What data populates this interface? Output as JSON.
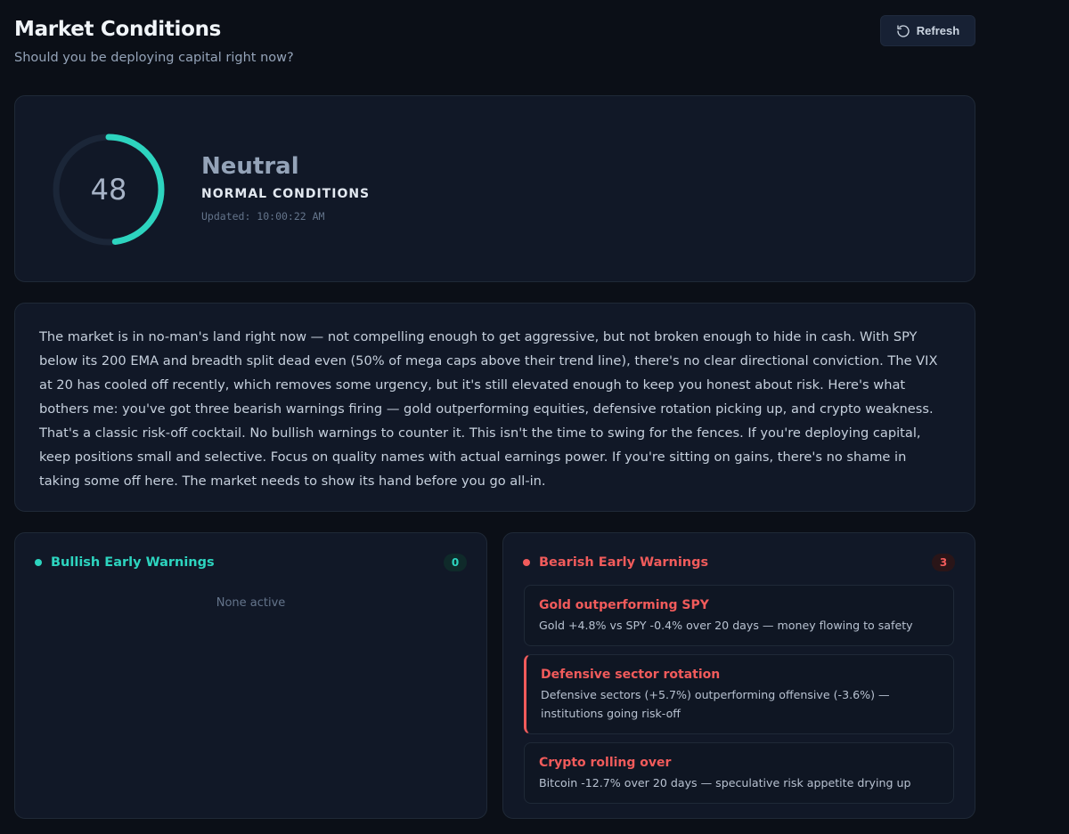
{
  "header": {
    "title": "Market Conditions",
    "subtitle": "Should you be deploying capital right now?",
    "refresh_label": "Refresh"
  },
  "score": {
    "value": 48,
    "max": 100,
    "label": "Neutral",
    "condition": "NORMAL CONDITIONS",
    "updated": "Updated: 10:00:22 AM",
    "accent_color": "#2dd4bf"
  },
  "summary": "The market is in no-man's land right now — not compelling enough to get aggressive, but not broken enough to hide in cash. With SPY below its 200 EMA and breadth split dead even (50% of mega caps above their trend line), there's no clear directional conviction. The VIX at 20 has cooled off recently, which removes some urgency, but it's still elevated enough to keep you honest about risk. Here's what bothers me: you've got three bearish warnings firing — gold outperforming equities, defensive rotation picking up, and crypto weakness. That's a classic risk-off cocktail. No bullish warnings to counter it. This isn't the time to swing for the fences. If you're deploying capital, keep positions small and selective. Focus on quality names with actual earnings power. If you're sitting on gains, there's no shame in taking some off here. The market needs to show its hand before you go all-in.",
  "bullish": {
    "title": "Bullish Early Warnings",
    "count": "0",
    "empty_text": "None active",
    "color": "#2dd4bf"
  },
  "bearish": {
    "title": "Bearish Early Warnings",
    "count": "3",
    "color": "#f15b5b",
    "items": [
      {
        "title": "Gold outperforming SPY",
        "description": "Gold +4.8% vs SPY -0.4% over 20 days — money flowing to safety"
      },
      {
        "title": "Defensive sector rotation",
        "description": "Defensive sectors (+5.7%) outperforming offensive (-3.6%) — institutions going risk-off"
      },
      {
        "title": "Crypto rolling over",
        "description": "Bitcoin -12.7% over 20 days — speculative risk appetite drying up"
      }
    ]
  }
}
